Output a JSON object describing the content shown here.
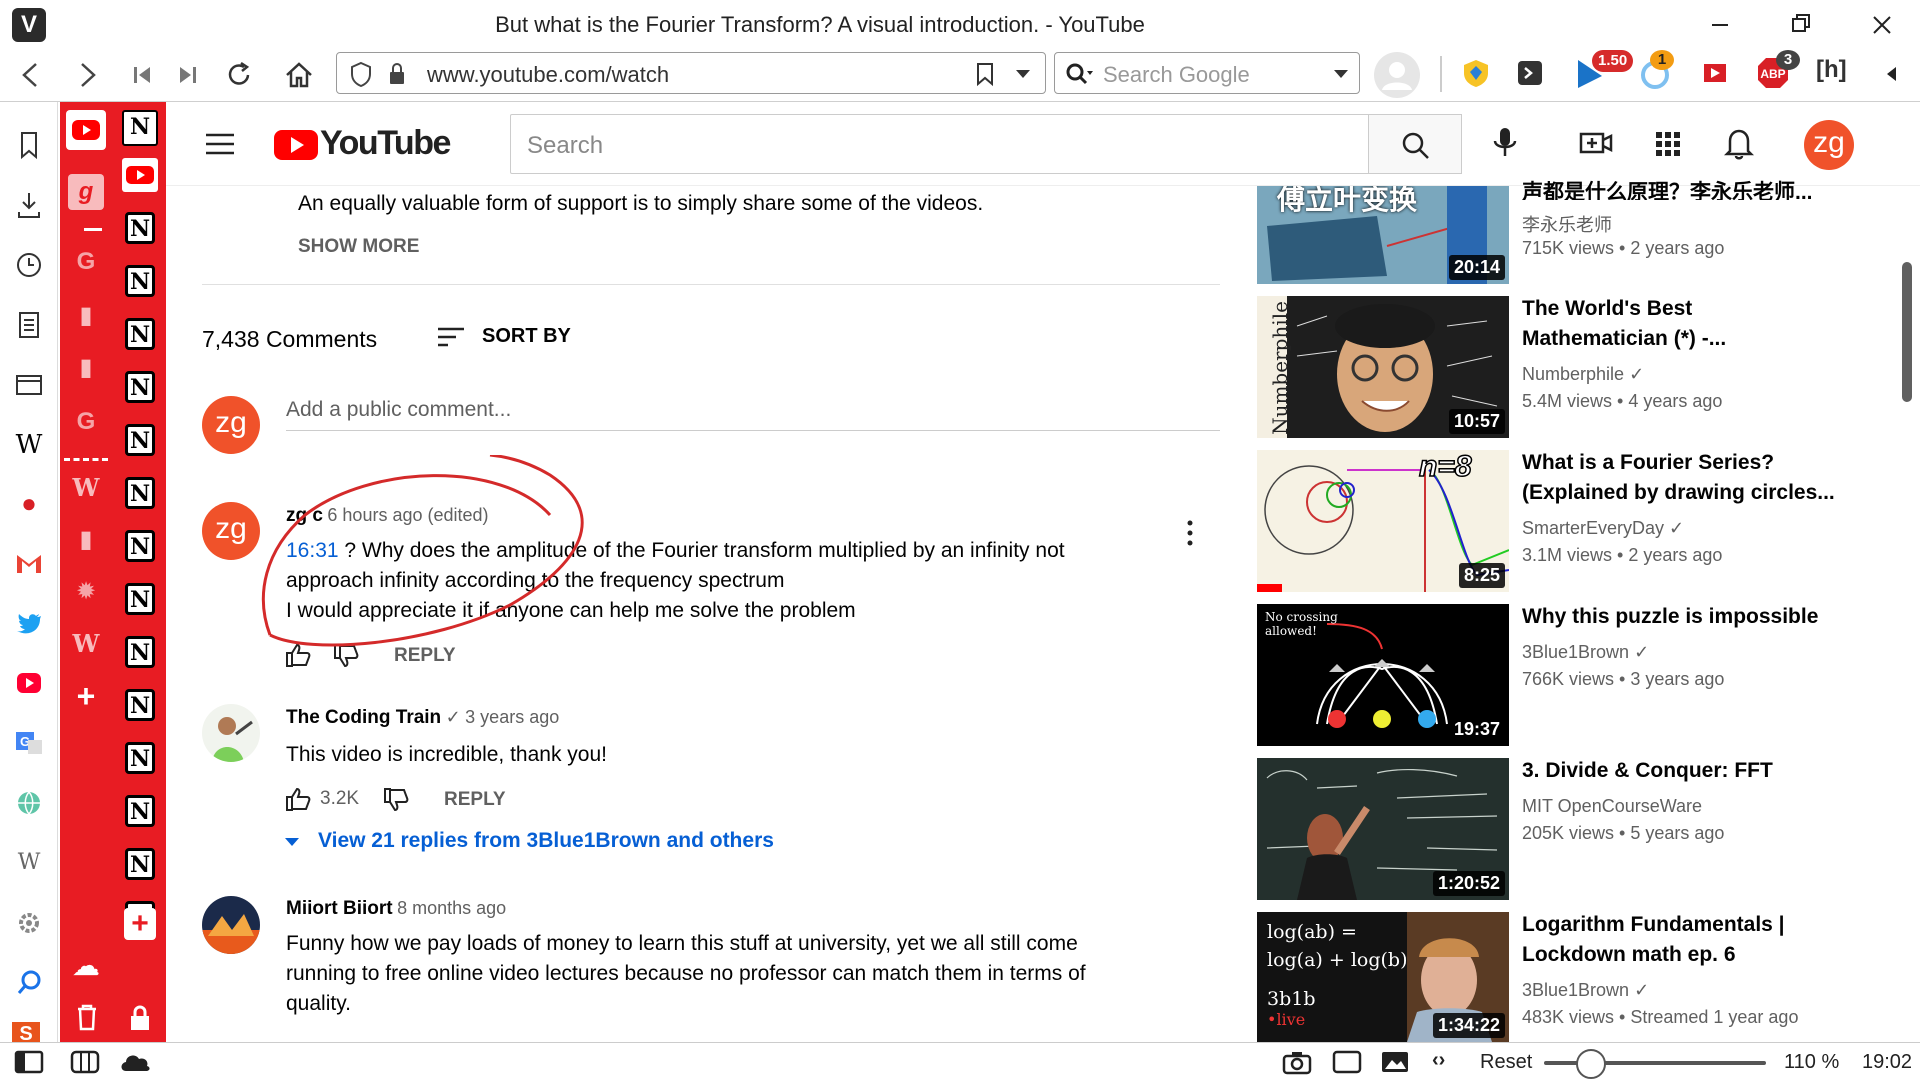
{
  "window": {
    "title": "But what is the Fourier Transform? A visual introduction. - YouTube"
  },
  "browser": {
    "url": "www.youtube.com/watch",
    "search_placeholder": "Search Google",
    "badges": {
      "ext1": "1.50",
      "ext2": "1",
      "ext3": "3"
    },
    "extension_label": "[h]"
  },
  "youtube": {
    "logo_text": "YouTube",
    "search_placeholder": "Search",
    "avatar_initials": "zg"
  },
  "description": {
    "line_partial": "An equally valuable form of support is to simply share some of the videos.",
    "show_more": "SHOW MORE"
  },
  "comments": {
    "count_label": "7,438 Comments",
    "sort_label": "SORT BY",
    "add_placeholder": "Add a public comment...",
    "items": [
      {
        "author": "zg c",
        "time": "6 hours ago (edited)",
        "timestamp_link": "16:31",
        "text1": " ? Why does the amplitude of the Fourier transform multiplied by an infinity not",
        "text2": "approach infinity according to the frequency spectrum",
        "text3": "I would appreciate it if anyone can help me solve the problem",
        "likes": "",
        "reply": "REPLY",
        "avatar": "zg"
      },
      {
        "author": "The Coding Train",
        "time": "3 years ago",
        "text1": "This video is incredible, thank you!",
        "likes": "3.2K",
        "reply": "REPLY",
        "view_replies": "View 21 replies from 3Blue1Brown and others"
      },
      {
        "author": "Miiort Biiort",
        "time": "8 months ago",
        "text1": "Funny how we pay loads of money to learn this stuff at university, yet we all still come",
        "text2": "running to free online video lectures because no professor can match them in terms of",
        "text3": "quality."
      }
    ]
  },
  "recommended": [
    {
      "title1": "声都是什么原理？李永乐老师...",
      "channel": "李永乐老师",
      "meta": "715K views • 2 years ago",
      "duration": "20:14",
      "thumb_text": "傅立叶变换"
    },
    {
      "title1": "The World's Best",
      "title2": "Mathematician (*) -...",
      "channel": "Numberphile",
      "meta": "5.4M views • 4 years ago",
      "duration": "10:57",
      "thumb_text": "Numberphile"
    },
    {
      "title1": "What is a Fourier Series?",
      "title2": "(Explained by drawing circles...",
      "channel": "SmarterEveryDay",
      "meta": "3.1M views • 2 years ago",
      "duration": "8:25",
      "thumb_text": "n=8"
    },
    {
      "title1": "Why this puzzle is impossible",
      "channel": "3Blue1Brown",
      "meta": "766K views • 3 years ago",
      "duration": "19:37",
      "thumb_text": "No crossing allowed!"
    },
    {
      "title1": "3. Divide & Conquer: FFT",
      "channel": "MIT OpenCourseWare",
      "meta": "205K views • 5 years ago",
      "duration": "1:20:52"
    },
    {
      "title1": "Logarithm Fundamentals |",
      "title2": "Lockdown math ep. 6",
      "channel": "3Blue1Brown",
      "meta": "483K views • Streamed 1 year ago",
      "duration": "1:34:22",
      "thumb_l1": "log(ab) =",
      "thumb_l2": "log(a) + log(b)",
      "thumb_l3": "3b1b",
      "thumb_l4": "•live"
    }
  ],
  "status": {
    "reset": "Reset",
    "zoom": "110 %",
    "clock": "19:02",
    "zoom_fraction": 0.12
  },
  "colors": {
    "accent_red": "#e81c23",
    "yt_red": "#ff0000",
    "link_blue": "#065fd4",
    "annotation_red": "#d42a2a"
  }
}
